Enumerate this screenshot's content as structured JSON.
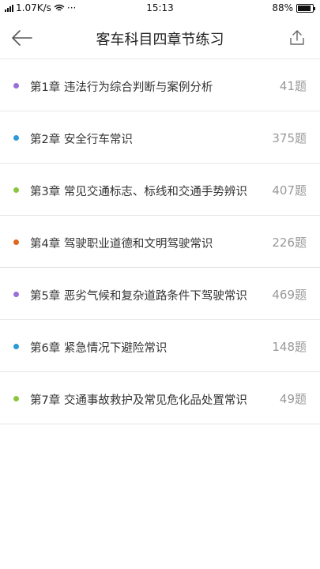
{
  "status": {
    "speed": "1.07K/s",
    "dots": "···",
    "time": "15:13",
    "battery_text": "88%",
    "battery_level": 0.88
  },
  "header": {
    "title": "客车科目四章节练习",
    "back_icon": "back-arrow-icon",
    "share_icon": "share-icon"
  },
  "chapters": [
    {
      "title": "第1章 违法行为综合判断与案例分析",
      "count": "41题",
      "color": "#9b6fd8"
    },
    {
      "title": "第2章 安全行车常识",
      "count": "375题",
      "color": "#2b9ad6"
    },
    {
      "title": "第3章 常见交通标志、标线和交通手势辨识",
      "count": "407题",
      "color": "#8cc63f"
    },
    {
      "title": "第4章 驾驶职业道德和文明驾驶常识",
      "count": "226题",
      "color": "#e0661e"
    },
    {
      "title": "第5章 恶劣气候和复杂道路条件下驾驶常识",
      "count": "469题",
      "color": "#9b6fd8"
    },
    {
      "title": "第6章 紧急情况下避险常识",
      "count": "148题",
      "color": "#2b9ad6"
    },
    {
      "title": "第7章 交通事故救护及常见危化品处置常识",
      "count": "49题",
      "color": "#8cc63f"
    }
  ]
}
